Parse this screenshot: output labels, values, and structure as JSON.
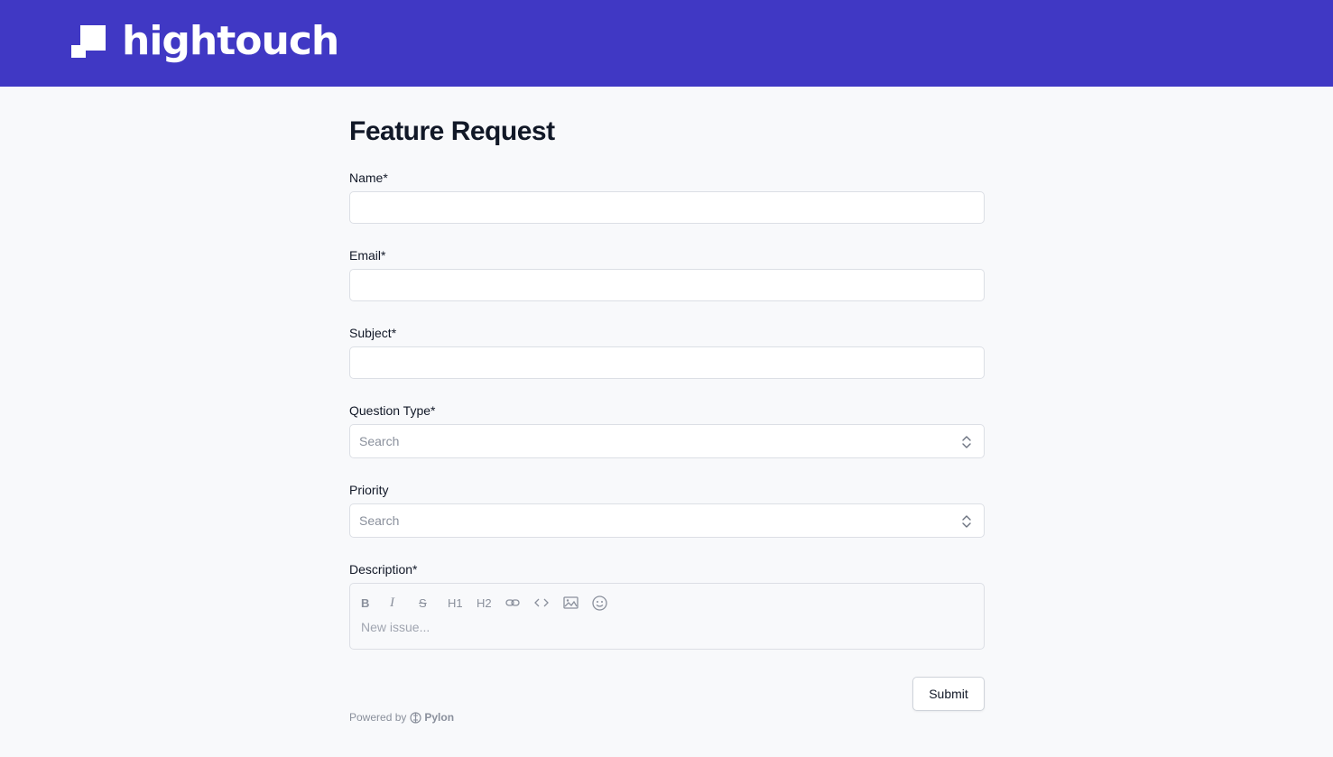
{
  "header": {
    "brand": "hightouch",
    "background": "#4038c4"
  },
  "form": {
    "title": "Feature Request",
    "fields": {
      "name": {
        "label": "Name*",
        "value": ""
      },
      "email": {
        "label": "Email*",
        "value": ""
      },
      "subject": {
        "label": "Subject*",
        "value": ""
      },
      "question_type": {
        "label": "Question Type*",
        "placeholder": "Search"
      },
      "priority": {
        "label": "Priority",
        "placeholder": "Search"
      },
      "description": {
        "label": "Description*",
        "placeholder": "New issue...",
        "toolbar": [
          "bold-icon",
          "italic-icon",
          "strikethrough-icon",
          "H1",
          "H2",
          "link-icon",
          "code-icon",
          "image-icon",
          "emoji-icon"
        ]
      }
    },
    "submit_label": "Submit"
  },
  "footer": {
    "powered_by": "Powered by",
    "brand": "Pylon"
  }
}
